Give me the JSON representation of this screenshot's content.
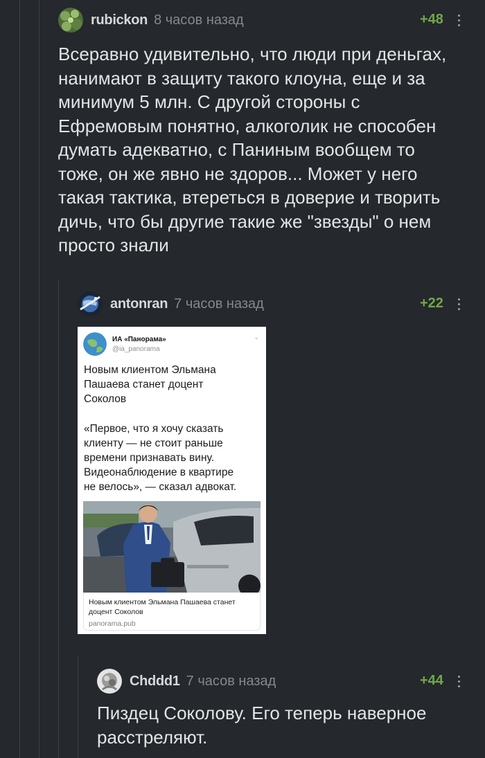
{
  "comments": [
    {
      "username": "rubickon",
      "time": "8 часов назад",
      "rating": "+48",
      "lines": [
        "Всеравно удивительно, что люди при деньгах,",
        "нанимают в защиту такого клоуна, еще и за",
        "минимум 5 млн. С другой стороны с",
        "Ефремовым понятно, алкоголик не способен",
        "думать адекватно, с Паниным вообщем то",
        "тоже, он же явно не здоров... Может у него",
        "такая тактика, втереться в доверие и творить",
        "дичь, что бы другие такие же \"звезды\" о нем",
        "просто знали"
      ]
    },
    {
      "username": "antonran",
      "time": "7 часов назад",
      "rating": "+22",
      "tweet": {
        "name": "ИА «Панорама»",
        "handle": "@ia_panorama",
        "headline_lines": [
          "Новым клиентом Эльмана",
          "Пашаева станет доцент",
          "Соколов"
        ],
        "quote_lines": [
          "«Первое, что я хочу сказать",
          "клиенту — не стоит раньше",
          "времени признавать вину.",
          "Видеонаблюдение в квартире",
          "не велось», — сказал адвокат."
        ],
        "link_title_lines": [
          "Новым клиентом Эльмана Пашаева станет",
          "доцент Соколов"
        ],
        "link_domain": "panorama.pub"
      }
    },
    {
      "username": "Chddd1",
      "time": "7 часов назад",
      "rating": "+44",
      "lines": [
        "Пиздец Соколову. Его теперь наверное",
        "расстреляют."
      ]
    }
  ],
  "icons": {
    "avatar_1": "moss-avatar",
    "avatar_2": "planet-avatar",
    "avatar_3": "gray-avatar",
    "menu": "kebab-menu-icon",
    "tweet_chevron": "chevron-down-icon"
  },
  "colors": {
    "background": "#25282c",
    "rating": "#72a84a",
    "text": "#e3e4e6",
    "muted": "#84898f",
    "thread_line": "#3d4146"
  }
}
